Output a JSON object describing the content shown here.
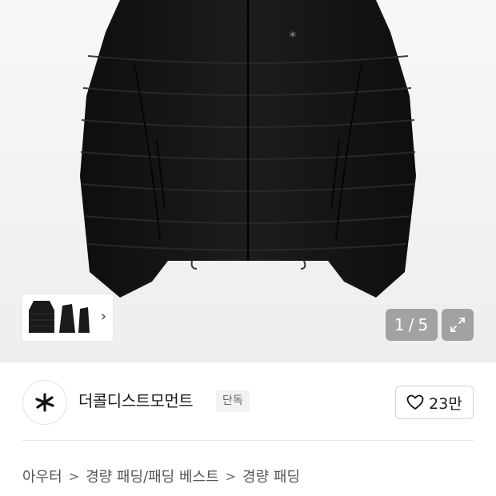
{
  "gallery": {
    "counter_current": "1",
    "counter_separator": "/",
    "counter_total": "5",
    "thumbnail_icon": "chevron-right-icon",
    "expand_icon": "expand-icon"
  },
  "brand": {
    "name": "더콜디스트모먼트",
    "badge": "단독",
    "logo_icon": "star-burst-logo-icon"
  },
  "like": {
    "icon": "heart-outline-icon",
    "count": "23만"
  },
  "breadcrumb": {
    "items": [
      "아우터",
      "경량 패딩/패딩 베스트",
      "경량 패딩"
    ],
    "separator": ">"
  },
  "colors": {
    "hero_bg": "#f2f2f4",
    "jacket": "#141414",
    "overlay": "rgba(0,0,0,0.32)",
    "text": "#1b1b1b"
  }
}
